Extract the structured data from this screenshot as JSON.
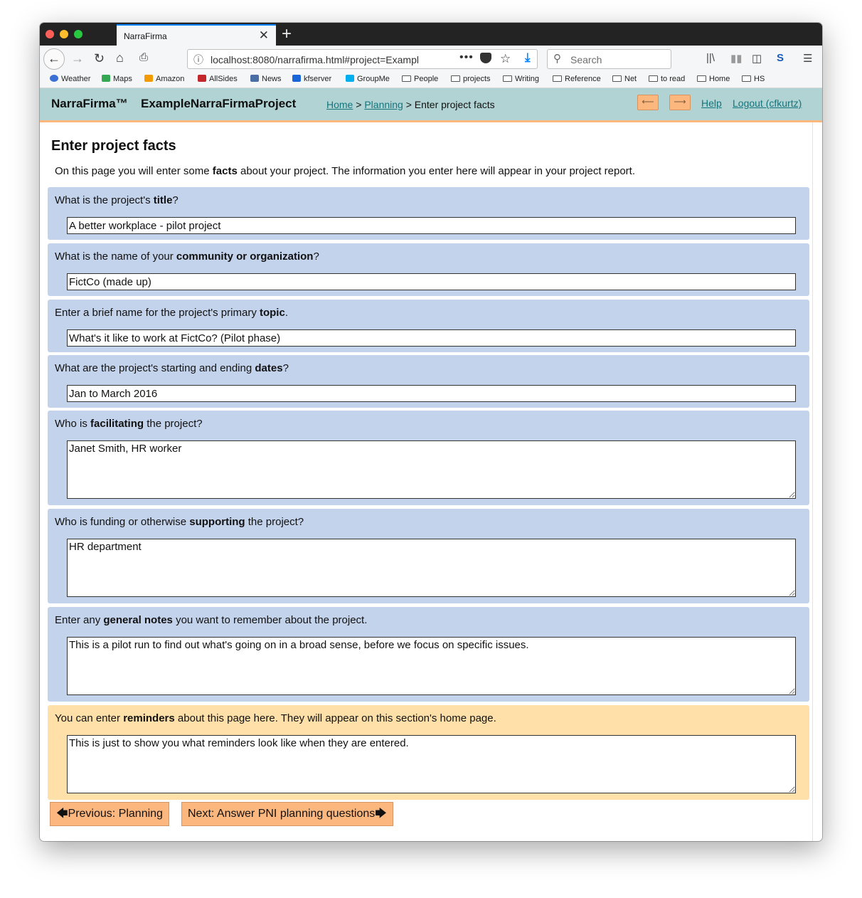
{
  "browser": {
    "tab_title": "NarraFirma",
    "tab_close": "✕",
    "new_tab": "+",
    "url": "localhost:8080/narrafirma.html#project=Exampl",
    "search_placeholder": "Search",
    "bookmarks": [
      {
        "label": "Weather",
        "icon": "weather-icon",
        "color": "#3b6fd6"
      },
      {
        "label": "Maps",
        "icon": "maps-icon",
        "color": "#34a853"
      },
      {
        "label": "Amazon",
        "icon": "amazon-icon",
        "color": "#f29a00"
      },
      {
        "label": "AllSides",
        "icon": "allsides-icon",
        "color": "#c3272b"
      },
      {
        "label": "News",
        "icon": "news-icon",
        "color": "#4a6fa5"
      },
      {
        "label": "kfserver",
        "icon": "kfserver-icon",
        "color": "#1a66d9"
      },
      {
        "label": "GroupMe",
        "icon": "groupme-icon",
        "color": "#00aff0"
      },
      {
        "label": "People",
        "icon": "folder-icon"
      },
      {
        "label": "projects",
        "icon": "folder-icon"
      },
      {
        "label": "Writing",
        "icon": "folder-icon"
      },
      {
        "label": "Reference",
        "icon": "folder-icon"
      },
      {
        "label": "Net",
        "icon": "folder-icon"
      },
      {
        "label": "to read",
        "icon": "folder-icon"
      },
      {
        "label": "Home",
        "icon": "folder-icon"
      },
      {
        "label": "HS",
        "icon": "folder-icon"
      }
    ]
  },
  "header": {
    "brand": "NarraFirma™",
    "project": "ExampleNarraFirmaProject",
    "breadcrumb_home": "Home",
    "breadcrumb_sep": ">",
    "breadcrumb_planning": "Planning",
    "breadcrumb_current": "Enter project facts",
    "prev_arrow": "⟵",
    "next_arrow": "⟶",
    "help": "Help",
    "logout": "Logout (cfkurtz)"
  },
  "page": {
    "title": "Enter project facts",
    "intro_pre": "On this page you will enter some ",
    "intro_bold": "facts",
    "intro_post": " about your project. The information you enter here will appear in your project report."
  },
  "questions": [
    {
      "pre": "What is the project's ",
      "bold": "title",
      "post": "?",
      "value": "A better workplace - pilot project"
    },
    {
      "pre": "What is the name of your ",
      "bold": "community or organization",
      "post": "?",
      "value": "FictCo (made up)"
    },
    {
      "pre": "Enter a brief name for the project's primary ",
      "bold": "topic",
      "post": ".",
      "value": "What's it like to work at FictCo? (Pilot phase)"
    },
    {
      "pre": "What are the project's starting and ending ",
      "bold": "dates",
      "post": "?",
      "value": "Jan to March 2016"
    },
    {
      "pre": "Who is ",
      "bold": "facilitating",
      "post": " the project?",
      "value": "Janet Smith, HR worker"
    },
    {
      "pre": "Who is funding or otherwise ",
      "bold": "supporting",
      "post": " the project?",
      "value": "HR department"
    },
    {
      "pre": "Enter any ",
      "bold": "general notes",
      "post": " you want to remember about the project.",
      "value": "This is a pilot run to find out what's going on in a broad sense, before we focus on specific issues."
    },
    {
      "pre": "You can enter ",
      "bold": "reminders",
      "post": " about this page here. They will appear on this section's home page.",
      "value": "This is just to show you what reminders look like when they are entered."
    }
  ],
  "buttons": {
    "previous": "Previous: Planning",
    "next": "Next: Answer PNI planning questions"
  },
  "colors": {
    "header_bg": "#b1d3d3",
    "accent_orange": "#fcb77f",
    "question_bg": "#c4d3ec",
    "reminder_bg": "#ffe0a8",
    "link": "#14757d"
  }
}
